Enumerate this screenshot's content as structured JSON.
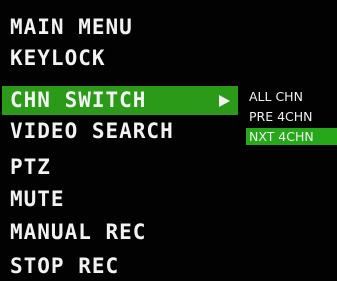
{
  "colors": {
    "background": "#020202",
    "text": "#f2f2f2",
    "highlight": "#2a9a18"
  },
  "menu": {
    "title": "MAIN MENU",
    "items": [
      {
        "label": "KEYLOCK"
      },
      {
        "label": "CHN SWITCH",
        "selected": true,
        "submenu_arrow_icon": "right-triangle-icon"
      },
      {
        "label": "VIDEO SEARCH"
      },
      {
        "label": "PTZ"
      },
      {
        "label": "MUTE"
      },
      {
        "label": "MANUAL REC"
      },
      {
        "label": "STOP REC"
      }
    ]
  },
  "submenu": {
    "items": [
      {
        "label": "ALL CHN"
      },
      {
        "label": "PRE 4CHN"
      },
      {
        "label": "NXT 4CHN",
        "selected": true
      }
    ]
  }
}
